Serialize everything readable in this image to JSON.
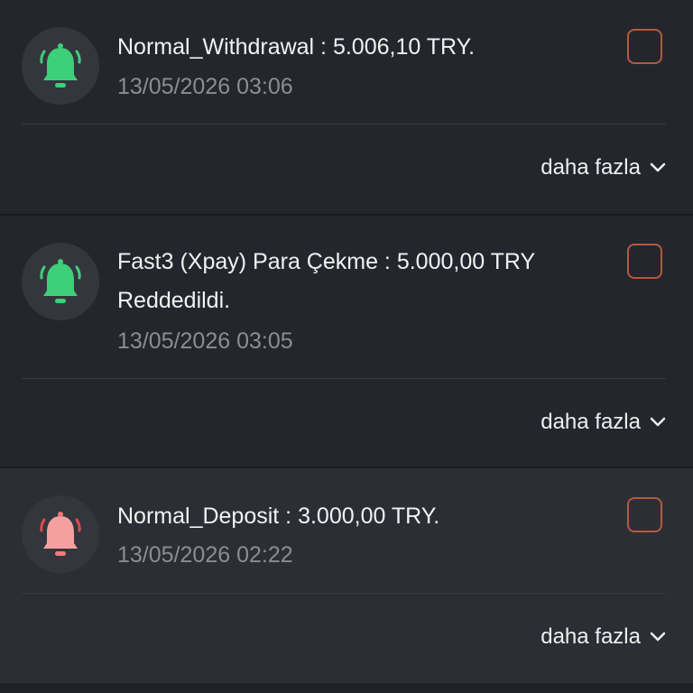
{
  "colors": {
    "success_bell": "#3ecf7a",
    "failure_bell": "#f07a7a",
    "checkbox_border": "#b5593c",
    "accent": "#d86a45"
  },
  "notifications": [
    {
      "icon": "bell-icon",
      "status": "success",
      "title": "Normal_Withdrawal : 5.006,10 TRY.",
      "time": "13/05/2026 03:06",
      "more_label": "daha fazla"
    },
    {
      "icon": "bell-icon",
      "status": "success",
      "title": "Fast3 (Xpay) Para Çekme : 5.000,00 TRY Reddedildi.",
      "time": "13/05/2026 03:05",
      "more_label": "daha fazla"
    },
    {
      "icon": "bell-icon",
      "status": "failure",
      "title": "Normal_Deposit : 3.000,00 TRY.",
      "time": "13/05/2026 02:22",
      "more_label": "daha fazla"
    }
  ]
}
